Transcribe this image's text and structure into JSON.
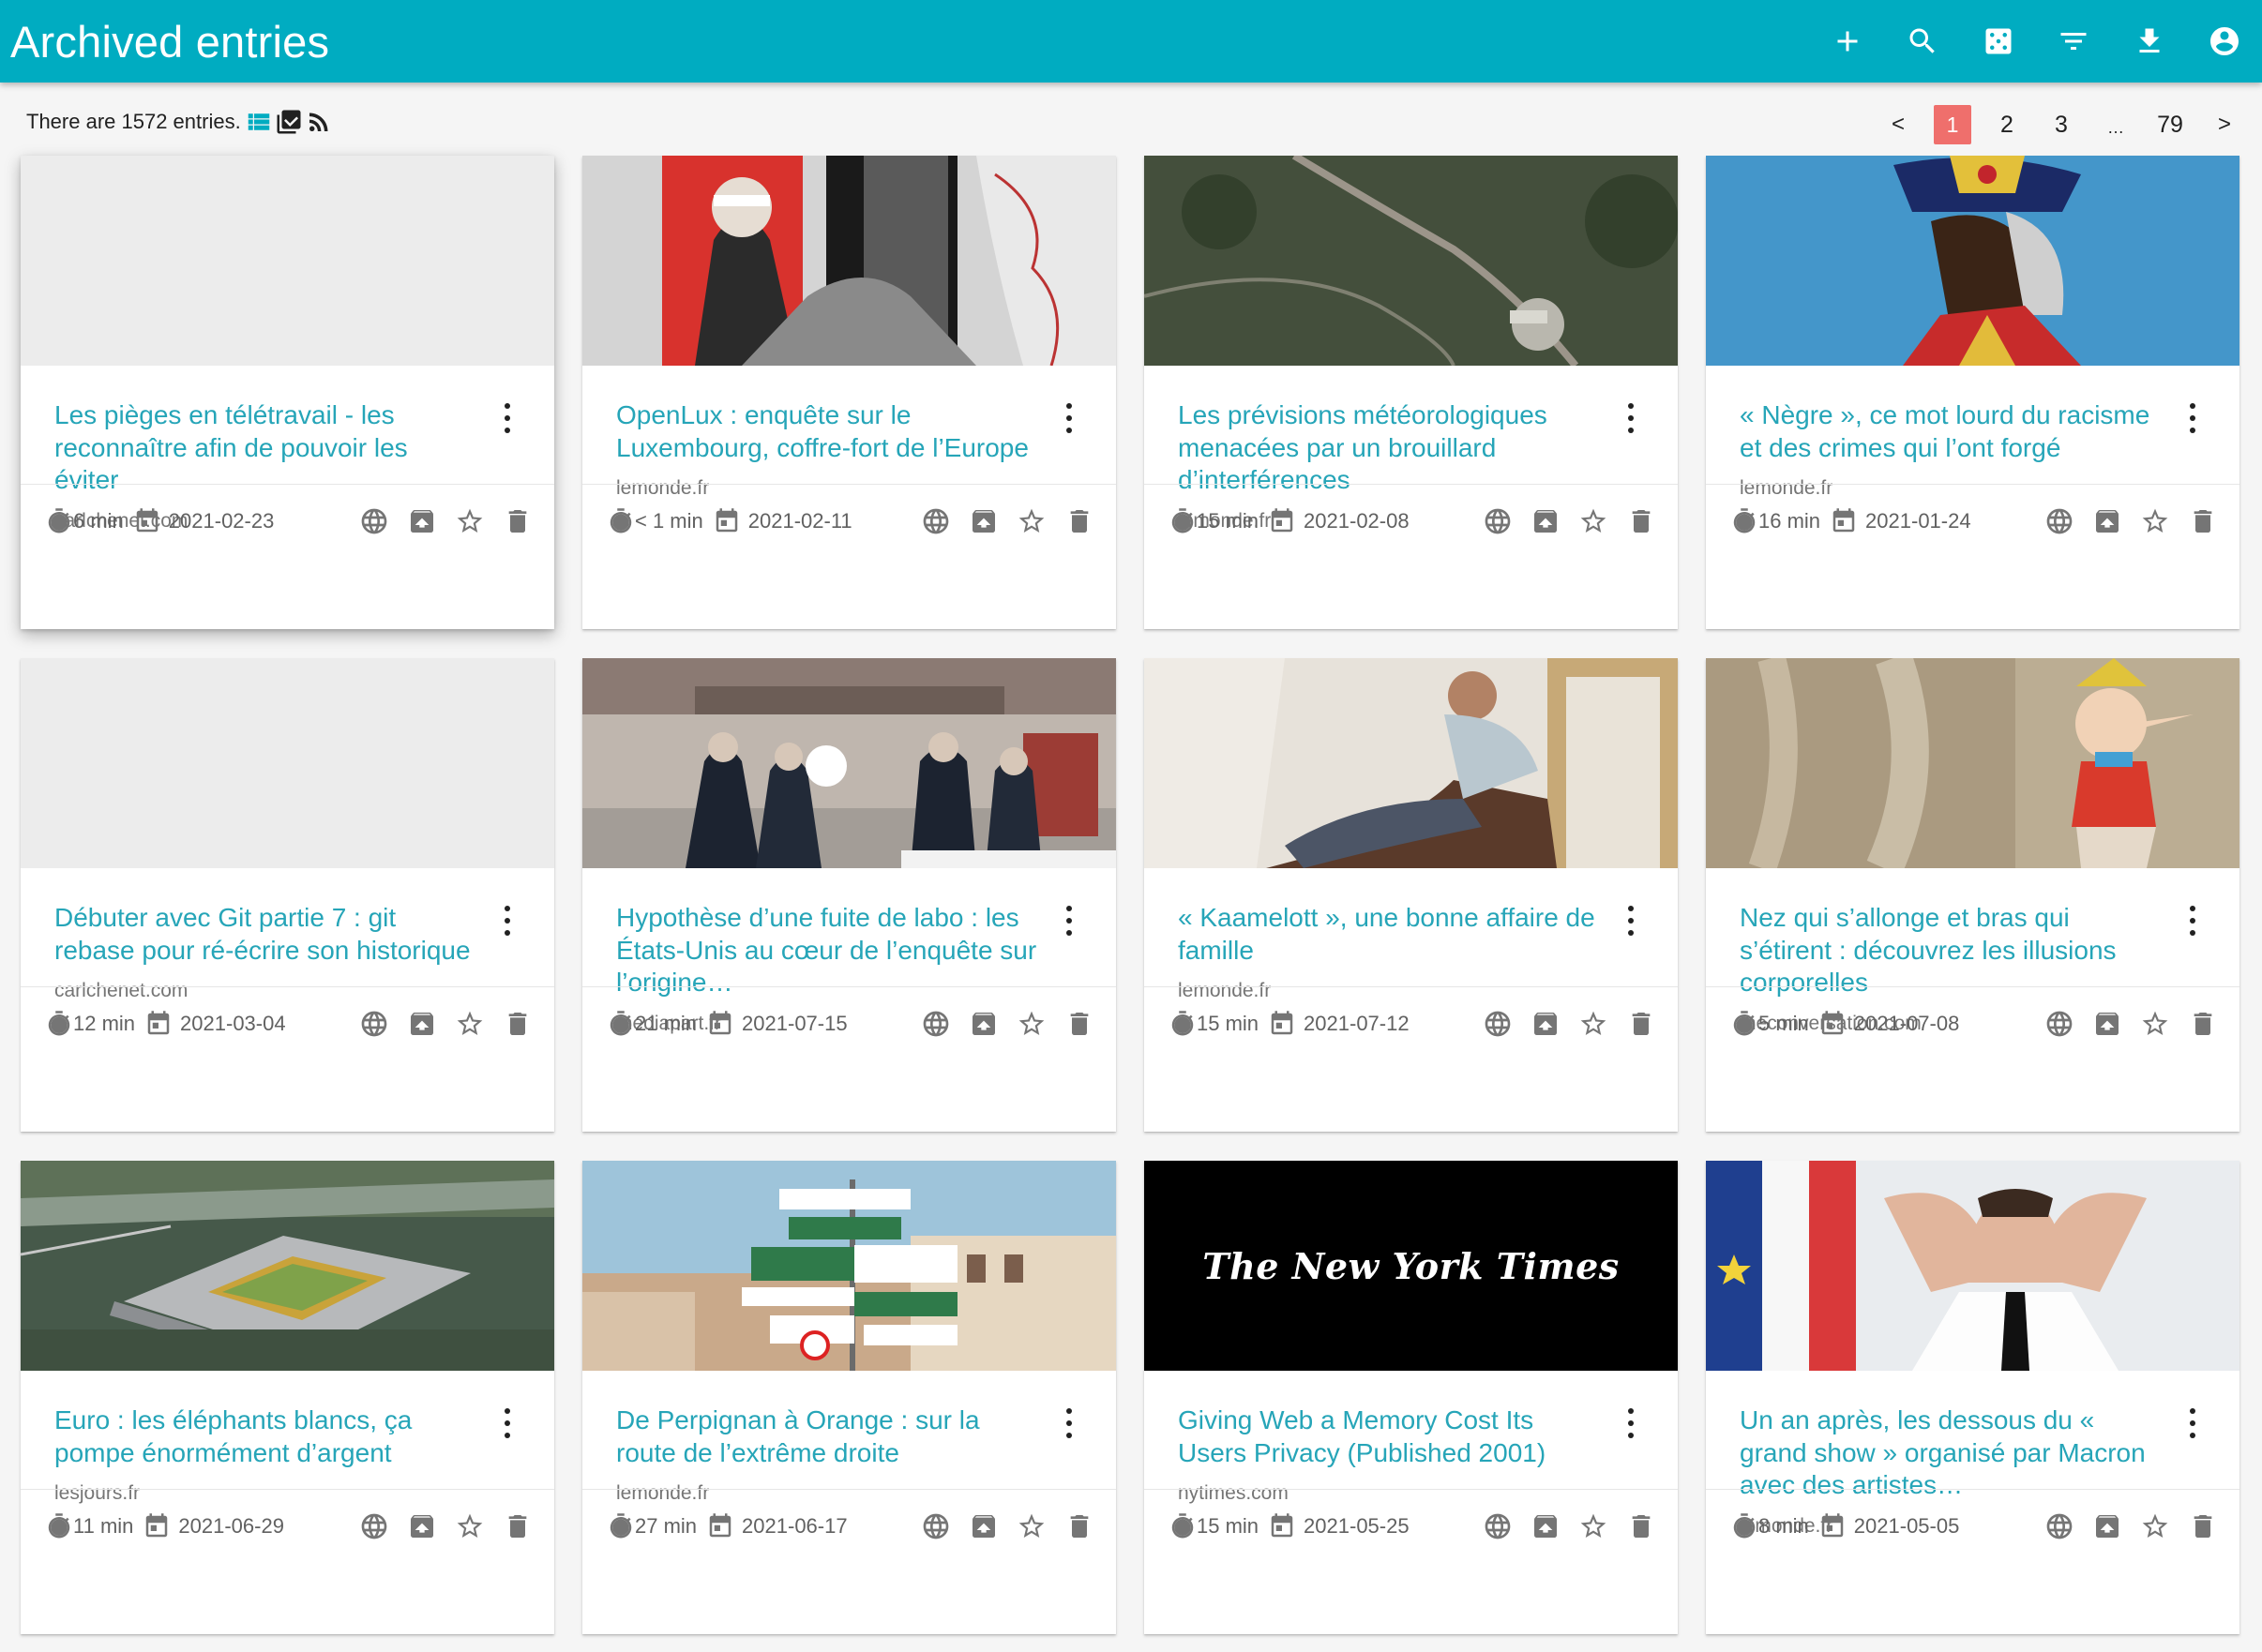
{
  "app": {
    "title": "Archived entries",
    "accent_color": "#00acc1",
    "link_color": "#26a5b8",
    "active_page_color": "#ef6f6c"
  },
  "toolbar": {
    "actions": [
      {
        "name": "add-entry-button",
        "icon": "plus-icon"
      },
      {
        "name": "search-button",
        "icon": "search-icon"
      },
      {
        "name": "random-entry-button",
        "icon": "dice-icon"
      },
      {
        "name": "filter-button",
        "icon": "filter-icon"
      },
      {
        "name": "export-button",
        "icon": "download-icon"
      },
      {
        "name": "account-button",
        "icon": "account-circle-icon"
      }
    ]
  },
  "summary": {
    "text": "There are 1572 entries.",
    "view_icons": [
      "list-view-icon",
      "select-mode-icon",
      "rss-feed-icon"
    ]
  },
  "pagination": {
    "prev": "<",
    "pages": [
      "1",
      "2",
      "3"
    ],
    "ellipsis": "…",
    "last": "79",
    "next": ">",
    "current": "1"
  },
  "entries": [
    {
      "title": "Les pièges en télétravail - les reconnaître afin de pouvoir les éviter",
      "domain": "carlchenet.com",
      "reading_time": "6 min",
      "date": "2021-02-23",
      "thumb": "blank"
    },
    {
      "title": "OpenLux : enquête sur le Luxembourg, coffre-fort de l’Europe",
      "domain": "lemonde.fr",
      "reading_time": "< 1 min",
      "date": "2021-02-11",
      "thumb": "collage"
    },
    {
      "title": "Les prévisions météorologiques menacées par un brouillard d’interférences",
      "domain": "lemonde.fr",
      "reading_time": "15 min",
      "date": "2021-02-08",
      "thumb": "aerial"
    },
    {
      "title": "« Nègre », ce mot lourd du racisme et des crimes qui l’ont forgé",
      "domain": "lemonde.fr",
      "reading_time": "16 min",
      "date": "2021-01-24",
      "thumb": "portrait"
    },
    {
      "title": "Débuter avec Git partie 7 : git rebase pour ré-écrire son historique",
      "domain": "carlchenet.com",
      "reading_time": "12 min",
      "date": "2021-03-04",
      "thumb": "blank"
    },
    {
      "title": "Hypothèse d’une fuite de labo : les États-Unis au cœur de l’enquête sur l’origine…",
      "domain": "mediapart.fr",
      "reading_time": "21 min",
      "date": "2021-07-15",
      "thumb": "wuhan"
    },
    {
      "title": "« Kaamelott », une bonne affaire de famille",
      "domain": "lemonde.fr",
      "reading_time": "15 min",
      "date": "2021-07-12",
      "thumb": "man"
    },
    {
      "title": "Nez qui s’allonge et bras qui s’étirent : découvrez les illusions corporelles",
      "domain": "theconversation.com",
      "reading_time": "5 min",
      "date": "2021-07-08",
      "thumb": "pinocchio"
    },
    {
      "title": "Euro : les éléphants blancs, ça pompe énormément d’argent",
      "domain": "lesjours.fr",
      "reading_time": "11 min",
      "date": "2021-06-29",
      "thumb": "stadium"
    },
    {
      "title": "De Perpignan à Orange : sur la route de l’extrême droite",
      "domain": "lemonde.fr",
      "reading_time": "27 min",
      "date": "2021-06-17",
      "thumb": "signs"
    },
    {
      "title": "Giving Web a Memory Cost Its Users Privacy (Published 2001)",
      "domain": "nytimes.com",
      "reading_time": "15 min",
      "date": "2021-05-25",
      "thumb": "nyt",
      "thumb_text": "The New York Times"
    },
    {
      "title": "Un an après, les dessous du « grand show » organisé par Macron avec des artistes…",
      "domain": "lemonde.fr",
      "reading_time": "8 min",
      "date": "2021-05-05",
      "thumb": "macron"
    }
  ],
  "card_actions": [
    "globe-icon",
    "archive-icon",
    "star-icon",
    "delete-icon"
  ]
}
